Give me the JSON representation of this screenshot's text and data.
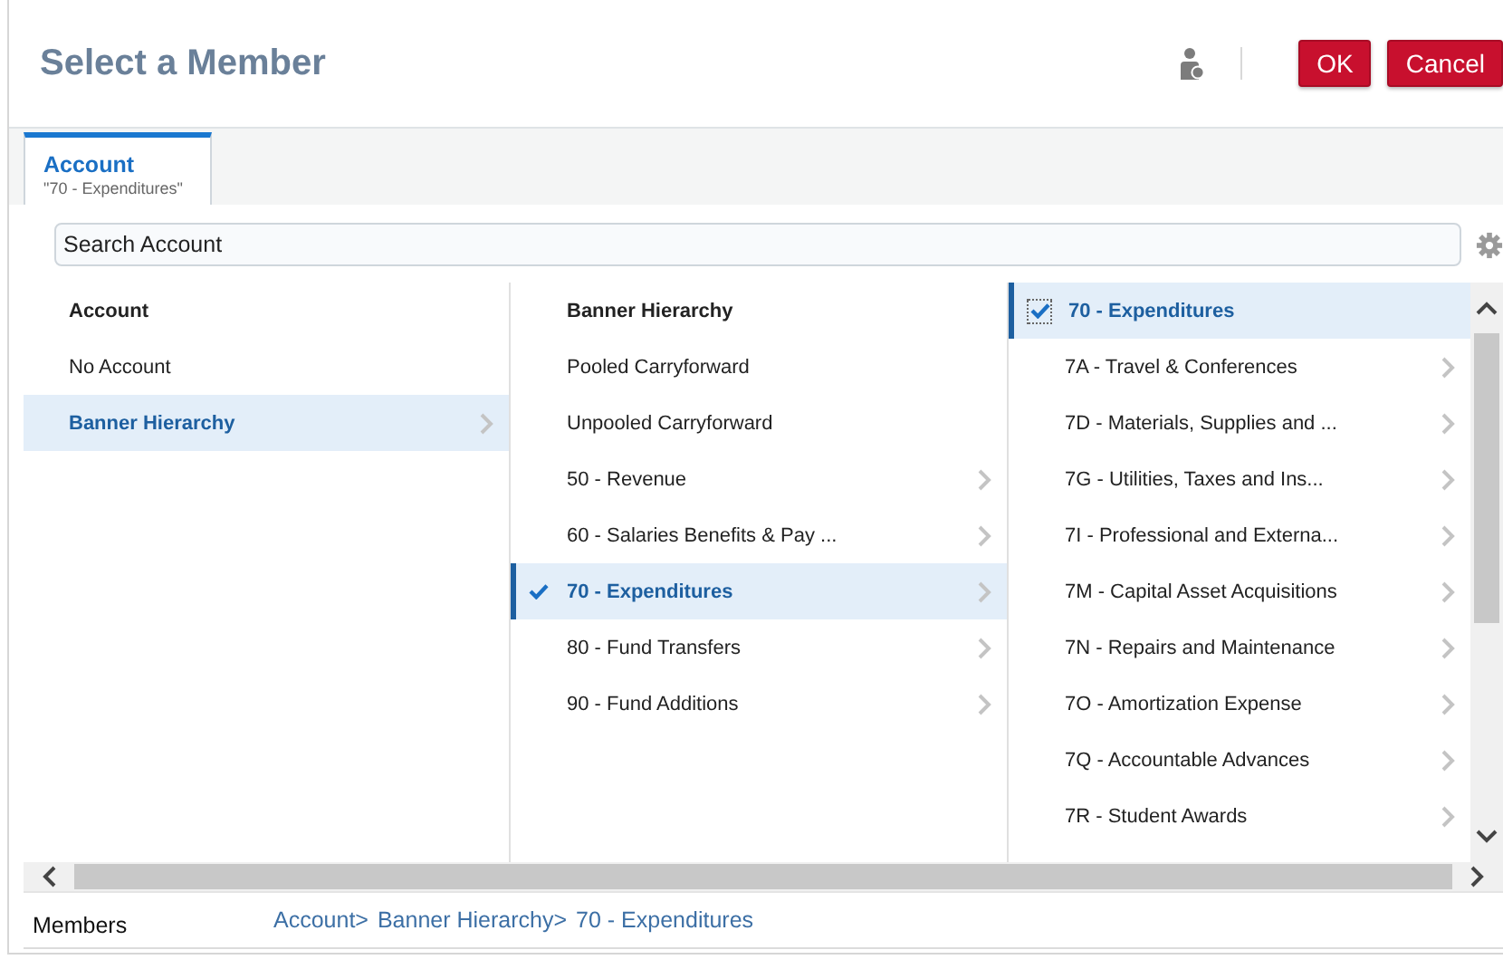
{
  "dialog": {
    "title": "Select a Member",
    "buttons": [
      "OK",
      "Cancel"
    ]
  },
  "tabs": [
    {
      "label": "Account",
      "sublabel": "\"70 - Expenditures\"",
      "selected": true
    }
  ],
  "search": {
    "placeholder": "Search Account"
  },
  "columns": [
    {
      "header": {
        "kind": "title",
        "label": "Account"
      },
      "items": [
        {
          "label": "No Account",
          "selected": false,
          "checked": false,
          "expandable": false
        },
        {
          "label": "Banner Hierarchy",
          "selected": true,
          "checked": false,
          "expandable": true
        }
      ]
    },
    {
      "header": {
        "kind": "title",
        "label": "Banner Hierarchy"
      },
      "items": [
        {
          "label": "Pooled Carryforward",
          "selected": false,
          "checked": false,
          "expandable": false
        },
        {
          "label": "Unpooled Carryforward",
          "selected": false,
          "checked": false,
          "expandable": false
        },
        {
          "label": "50 - Revenue",
          "selected": false,
          "checked": false,
          "expandable": true
        },
        {
          "label": "60 - Salaries Benefits & Pay ...",
          "selected": false,
          "checked": false,
          "expandable": true
        },
        {
          "label": "70 - Expenditures",
          "selected": true,
          "checked": true,
          "expandable": true
        },
        {
          "label": "80 - Fund Transfers",
          "selected": false,
          "checked": false,
          "expandable": true
        },
        {
          "label": "90 - Fund Additions",
          "selected": false,
          "checked": false,
          "expandable": true
        }
      ]
    },
    {
      "header": {
        "kind": "checkable",
        "label": "70 - Expenditures",
        "checked": true,
        "selected": true
      },
      "items": [
        {
          "label": "7A - Travel & Conferences",
          "selected": false,
          "checked": false,
          "expandable": true
        },
        {
          "label": "7D - Materials, Supplies and ...",
          "selected": false,
          "checked": false,
          "expandable": true
        },
        {
          "label": "7G - Utilities, Taxes and Ins...",
          "selected": false,
          "checked": false,
          "expandable": true
        },
        {
          "label": "7I - Professional and Externa...",
          "selected": false,
          "checked": false,
          "expandable": true
        },
        {
          "label": "7M - Capital Asset Acquisitions",
          "selected": false,
          "checked": false,
          "expandable": true
        },
        {
          "label": "7N - Repairs and Maintenance",
          "selected": false,
          "checked": false,
          "expandable": true
        },
        {
          "label": "7O - Amortization Expense",
          "selected": false,
          "checked": false,
          "expandable": true
        },
        {
          "label": "7Q - Accountable Advances",
          "selected": false,
          "checked": false,
          "expandable": true
        },
        {
          "label": "7R - Student Awards",
          "selected": false,
          "checked": false,
          "expandable": true
        }
      ]
    }
  ],
  "footer": {
    "label": "Members",
    "breadcrumb": [
      "Account>",
      "Banner Hierarchy>",
      "70 - Expenditures"
    ]
  }
}
